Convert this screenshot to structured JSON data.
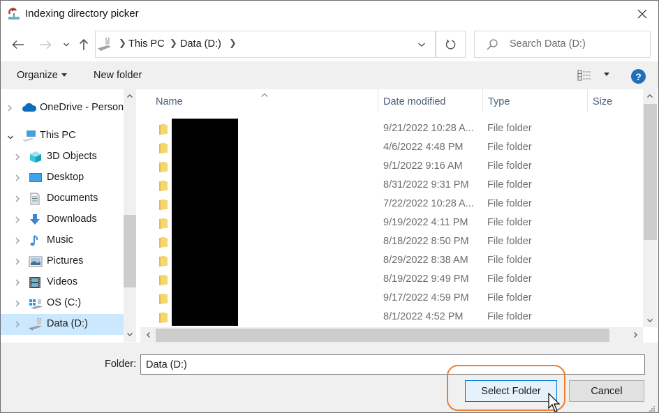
{
  "window": {
    "title": "Indexing directory picker",
    "icons": {
      "app": "indexing-app-icon",
      "close": "close-icon"
    }
  },
  "nav": {
    "back": "back-arrow-icon",
    "forward": "forward-arrow-icon",
    "recent": "chevron-down-icon",
    "up": "up-arrow-icon",
    "breadcrumb": [
      "This PC",
      "Data (D:)"
    ],
    "search_placeholder": "Search Data (D:)"
  },
  "toolbar": {
    "organize_label": "Organize",
    "new_folder_label": "New folder",
    "help_label": "?"
  },
  "tree": [
    {
      "label": "OneDrive - Person",
      "icon": "onedrive-cloud-icon",
      "level": 0,
      "expanded": false,
      "selected": false
    },
    {
      "label": "This PC",
      "icon": "this-pc-icon",
      "level": 0,
      "expanded": true,
      "selected": false
    },
    {
      "label": "3D Objects",
      "icon": "3d-objects-icon",
      "level": 1,
      "expanded": false,
      "selected": false
    },
    {
      "label": "Desktop",
      "icon": "desktop-icon",
      "level": 1,
      "expanded": false,
      "selected": false
    },
    {
      "label": "Documents",
      "icon": "documents-icon",
      "level": 1,
      "expanded": false,
      "selected": false
    },
    {
      "label": "Downloads",
      "icon": "downloads-icon",
      "level": 1,
      "expanded": false,
      "selected": false
    },
    {
      "label": "Music",
      "icon": "music-icon",
      "level": 1,
      "expanded": false,
      "selected": false
    },
    {
      "label": "Pictures",
      "icon": "pictures-icon",
      "level": 1,
      "expanded": false,
      "selected": false
    },
    {
      "label": "Videos",
      "icon": "videos-icon",
      "level": 1,
      "expanded": false,
      "selected": false
    },
    {
      "label": "OS (C:)",
      "icon": "os-drive-icon",
      "level": 1,
      "expanded": false,
      "selected": false
    },
    {
      "label": "Data (D:)",
      "icon": "data-drive-icon",
      "level": 1,
      "expanded": false,
      "selected": true
    }
  ],
  "columns": [
    "Name",
    "Date modified",
    "Type",
    "Size"
  ],
  "files": [
    {
      "name": "[redacted]",
      "date": "9/21/2022 10:28 A...",
      "type": "File folder",
      "size": ""
    },
    {
      "name": "[redacted]",
      "date": "4/6/2022 4:48 PM",
      "type": "File folder",
      "size": ""
    },
    {
      "name": "[redacted]",
      "date": "9/1/2022 9:16 AM",
      "type": "File folder",
      "size": ""
    },
    {
      "name": "[redacted]",
      "date": "8/31/2022 9:31 PM",
      "type": "File folder",
      "size": ""
    },
    {
      "name": "[redacted]",
      "date": "7/22/2022 10:28 A...",
      "type": "File folder",
      "size": ""
    },
    {
      "name": "[redacted]",
      "date": "9/19/2022 4:11 PM",
      "type": "File folder",
      "size": ""
    },
    {
      "name": "[redacted]",
      "date": "8/18/2022 8:50 PM",
      "type": "File folder",
      "size": ""
    },
    {
      "name": "[redacted]",
      "date": "8/29/2022 8:38 AM",
      "type": "File folder",
      "size": ""
    },
    {
      "name": "[redacted]",
      "date": "8/19/2022 9:49 PM",
      "type": "File folder",
      "size": ""
    },
    {
      "name": "[redacted]",
      "date": "9/17/2022 4:59 PM",
      "type": "File folder",
      "size": ""
    },
    {
      "name": "[redacted]",
      "date": "8/1/2022 4:52 PM",
      "type": "File folder",
      "size": ""
    }
  ],
  "footer": {
    "folder_label": "Folder:",
    "folder_value": "Data (D:)",
    "select_label": "Select Folder",
    "cancel_label": "Cancel"
  },
  "colors": {
    "accent": "#0078d7",
    "selection": "#cce8ff",
    "annotation_ring": "#ed7d31",
    "help_icon": "#1f6fba",
    "folder_icon": "#f5d76e"
  }
}
